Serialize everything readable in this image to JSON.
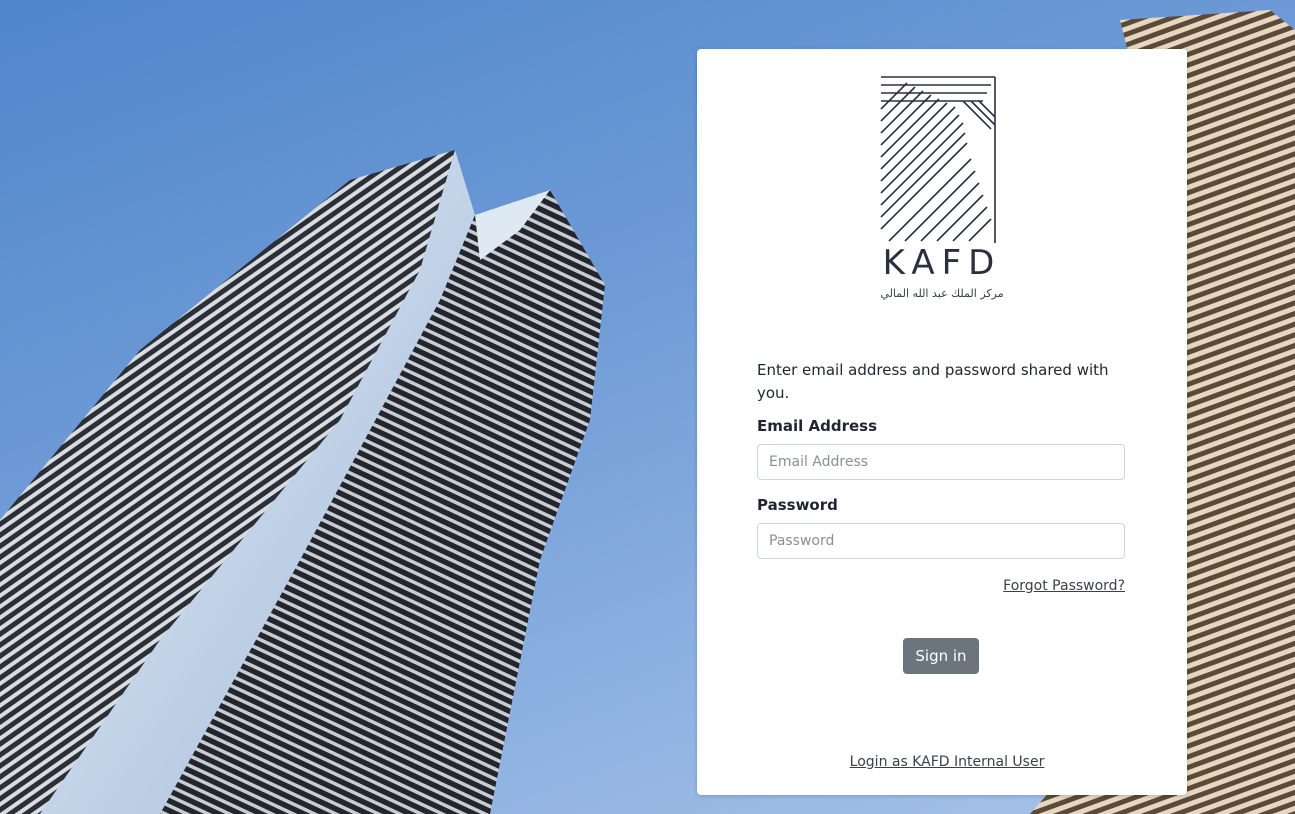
{
  "background": {
    "description_icon": "skyscraper-photo",
    "sky_color": "#6f9bd6"
  },
  "logo": {
    "wordmark": "KAFD",
    "arabic_name": "مركز الملك عبد الله المالي",
    "icon": "kafd-building-logo-icon",
    "color": "#2b3040"
  },
  "form": {
    "instructions": "Enter email address and password shared with you.",
    "email_label": "Email Address",
    "email_placeholder": "Email Address",
    "email_value": "",
    "password_label": "Password",
    "password_placeholder": "Password",
    "password_value": "",
    "forgot_link": "Forgot Password?",
    "signin_button": "Sign in",
    "signin_button_color": "#6c757d"
  },
  "footer": {
    "internal_login_link": "Login as KAFD Internal User"
  }
}
